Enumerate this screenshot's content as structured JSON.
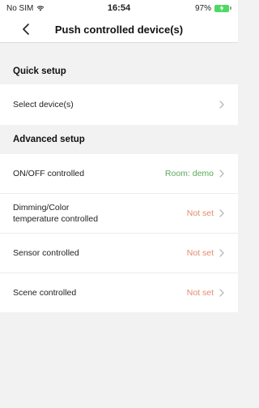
{
  "status_bar": {
    "carrier": "No SIM",
    "time": "16:54",
    "battery": "97%"
  },
  "nav": {
    "title": "Push controlled device(s)"
  },
  "sections": {
    "quick": {
      "title": "Quick setup",
      "items": [
        {
          "label": "Select device(s)",
          "value": ""
        }
      ]
    },
    "advanced": {
      "title": "Advanced setup",
      "items": [
        {
          "label": "ON/OFF controlled",
          "value": "Room: demo"
        },
        {
          "label_line1": "Dimming/Color",
          "label_line2": "temperature controlled",
          "value": "Not set"
        },
        {
          "label": "Sensor controlled",
          "value": "Not set"
        },
        {
          "label": "Scene controlled",
          "value": "Not set"
        }
      ]
    }
  },
  "colors": {
    "value_set": "#5aa85a",
    "value_not_set": "#e58a6f",
    "chevron": "#b8b8b8",
    "background": "#f2f2f2"
  }
}
